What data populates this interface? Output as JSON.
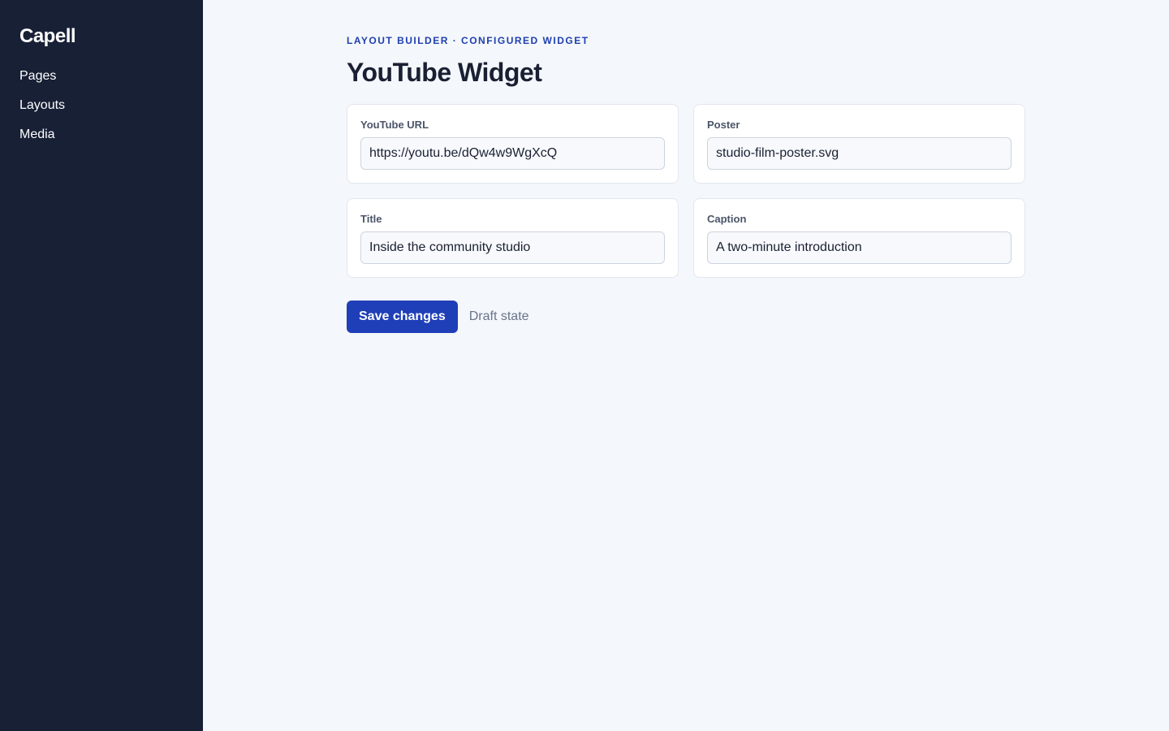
{
  "sidebar": {
    "brand": "Capell",
    "items": [
      {
        "label": "Pages"
      },
      {
        "label": "Layouts"
      },
      {
        "label": "Media"
      }
    ]
  },
  "header": {
    "eyebrow": "LAYOUT BUILDER · CONFIGURED WIDGET",
    "title": "YouTube Widget"
  },
  "fields": [
    {
      "label": "YouTube URL",
      "value": "https://youtu.be/dQw4w9WgXcQ"
    },
    {
      "label": "Poster",
      "value": "studio-film-poster.svg"
    },
    {
      "label": "Title",
      "value": "Inside the community studio"
    },
    {
      "label": "Caption",
      "value": "A two-minute introduction"
    }
  ],
  "actions": {
    "save_label": "Save changes",
    "status": "Draft state"
  },
  "colors": {
    "sidebar_bg": "#182036",
    "page_bg": "#f4f7fb",
    "accent": "#1f3fb8",
    "eyebrow": "#1f3fae"
  }
}
